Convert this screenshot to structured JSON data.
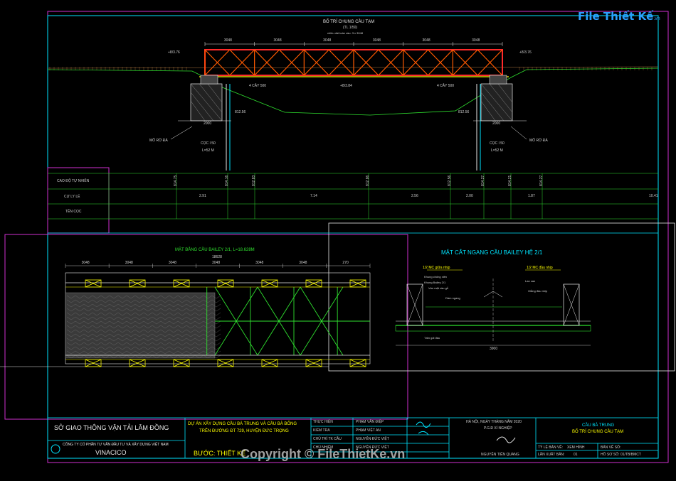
{
  "watermark": {
    "logo_text": "File Thiết Kế",
    "logo_domain": ".vn",
    "copyright": "Copyright © FileThietKe.vn"
  },
  "elevation": {
    "title": "BỐ TRÍ CHUNG CẦU TẠM",
    "scale": "(TL 1/50)",
    "note": "chiều dài toàn cầu: 3 x 3048",
    "spans": [
      "3048",
      "3048",
      "3048",
      "3048",
      "3048",
      "3048"
    ],
    "levels": {
      "left_top": "+8/3.76",
      "right_top": "+8/3.76",
      "left_mid": "4 CÂY 500",
      "center_mid": "+8/3.84",
      "right_mid": "4 CÂY 500",
      "left_low": "812.56",
      "right_low": "812.56"
    },
    "left_pile": {
      "label": "MỐ RỜ ĐÁ",
      "coc": "CỌC I 50",
      "length": "L=52 M",
      "dim": "2000"
    },
    "right_pile": {
      "label": "MỐ RỜ ĐÁ",
      "coc": "CỌC I 50",
      "length": "L=52 M",
      "dim": "2000"
    }
  },
  "profile_table": {
    "rows": [
      {
        "label": "CAO ĐỘ TỰ NHIÊN"
      },
      {
        "label": "CỰ LY LẺ"
      },
      {
        "label": "TÊN CỌC"
      }
    ],
    "elevations": [
      "814.75",
      "814.16",
      "812.83",
      "812.86",
      "812.56",
      "814.27",
      "814.21",
      "814.27"
    ],
    "distances": [
      "2.91",
      "7.14",
      "2.56",
      "2.00",
      "1.87",
      "10.41"
    ]
  },
  "plan": {
    "title": "MẶT BẰNG CẦU BAILEY 2/1, L=18.628M",
    "total": "18628",
    "spans": [
      "3048",
      "3048",
      "3048",
      "3048",
      "3048",
      "3048",
      "270"
    ]
  },
  "cross_section": {
    "title": "MẶT CẮT NGANG CẦU BAILEY HỆ 2/1",
    "left_label": "1/2 MC giữa nhịp",
    "right_label": "1/2 MC đầu nhịp",
    "width_dim": "3900",
    "callouts": [
      "Khung chống xiên",
      "Khung Bailey 2/1",
      "Ván mặt cầu gỗ",
      "Dầm ngang",
      "Lan can",
      "Giằng đầu nhịp",
      "Tấm gối đầu"
    ]
  },
  "title_block": {
    "department": "SỞ GIAO THÔNG VẬN TẢI LÂM ĐỒNG",
    "company": "CÔNG TY CỔ PHẦN TƯ VẤN ĐẦU TƯ VÀ XÂY DỰNG VIỆT NAM",
    "company_short": "VINACICO",
    "project_line1": "DỰ ÁN XÂY DỰNG CẦU BÀ TRUNG VÀ CẦU BÀ BỐNG",
    "project_line2": "TRÊN ĐƯỜNG ĐT 729, HUYỆN ĐỨC TRỌNG",
    "stage": "BƯỚC: THIẾT KẾ",
    "roles": [
      {
        "role": "THỰC HIỆN",
        "name": "PHẠM VĂN ĐIỆP"
      },
      {
        "role": "KIỂM TRA",
        "name": "PHẠM VIỆT AN"
      },
      {
        "role": "CHỦ TRÌ TK CẦU",
        "name": "NGUYỄN ĐỨC VIỆT"
      },
      {
        "role": "CHỦ NHIỆM",
        "name": "NGUYỄN ĐỨC VIỆT"
      }
    ],
    "date_line": "HÀ NỘI, NGÀY   THÁNG   NĂM 2020",
    "director_title": "P.G.Đ XÍ NGHIỆP",
    "director_name": "NGUYỄN TIẾN QUANG",
    "drawing_title1": "CẦU BÀ TRUNG",
    "drawing_title2": "BỐ TRÍ CHUNG CẦU TẠM",
    "scale_label": "TỶ LỆ BẢN VẼ:",
    "scale_value": "XEM HÌNH",
    "sheet_label": "BẢN VẼ SỐ:",
    "version_label": "LẦN XUẤT BẢN:",
    "version_value": "01",
    "file_label": "HỒ SƠ SỐ:",
    "file_value": "01/TB/BMCT"
  }
}
